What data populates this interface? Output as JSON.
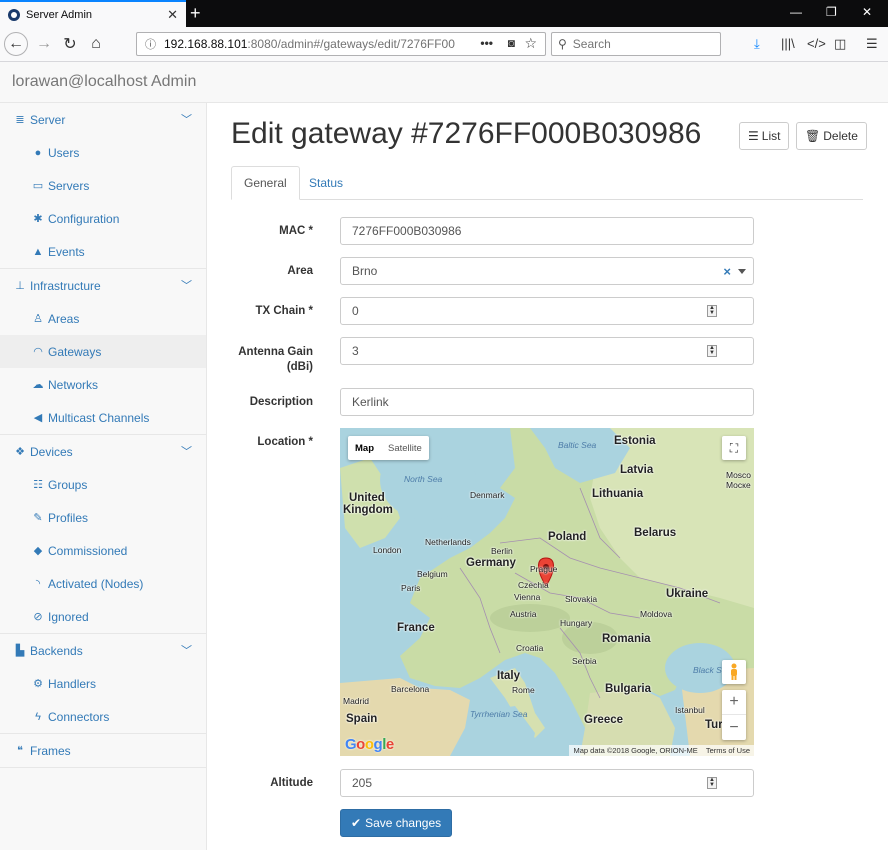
{
  "browser": {
    "tab_title": "Server Admin",
    "url_host": "192.168.88.101",
    "url_path": ":8080/admin#/gateways/edit/7276FF00",
    "search_placeholder": "Search"
  },
  "app": {
    "header_title": "lorawan@localhost Admin"
  },
  "sidebar": {
    "sections": [
      {
        "label": "Server",
        "icon": "server-icon",
        "items": [
          {
            "label": "Users",
            "icon": "user-icon"
          },
          {
            "label": "Servers",
            "icon": "monitor-icon"
          },
          {
            "label": "Configuration",
            "icon": "gear-icon"
          },
          {
            "label": "Events",
            "icon": "warning-icon"
          }
        ]
      },
      {
        "label": "Infrastructure",
        "icon": "sitemap-icon",
        "items": [
          {
            "label": "Areas",
            "icon": "person-pin-icon"
          },
          {
            "label": "Gateways",
            "icon": "wifi-icon"
          },
          {
            "label": "Networks",
            "icon": "cloud-icon"
          },
          {
            "label": "Multicast Channels",
            "icon": "bullhorn-icon"
          }
        ]
      },
      {
        "label": "Devices",
        "icon": "cubes-icon",
        "items": [
          {
            "label": "Groups",
            "icon": "grid-icon"
          },
          {
            "label": "Profiles",
            "icon": "edit-icon"
          },
          {
            "label": "Commissioned",
            "icon": "cube-icon"
          },
          {
            "label": "Activated (Nodes)",
            "icon": "rss-icon"
          },
          {
            "label": "Ignored",
            "icon": "ban-icon"
          }
        ]
      },
      {
        "label": "Backends",
        "icon": "chart-icon",
        "items": [
          {
            "label": "Handlers",
            "icon": "cogs-icon"
          },
          {
            "label": "Connectors",
            "icon": "bolt-icon"
          }
        ]
      },
      {
        "label": "Frames",
        "icon": "comments-icon",
        "items": []
      }
    ]
  },
  "page": {
    "title": "Edit gateway #7276FF000B030986",
    "list_label": "List",
    "delete_label": "Delete",
    "tabs": [
      "General",
      "Status"
    ],
    "active_tab": "General"
  },
  "form": {
    "mac_label": "MAC *",
    "mac_value": "7276FF000B030986",
    "area_label": "Area",
    "area_value": "Brno",
    "txchain_label": "TX Chain *",
    "txchain_value": "0",
    "antenna_label_1": "Antenna Gain",
    "antenna_label_2": "(dBi)",
    "antenna_value": "3",
    "description_label": "Description",
    "description_value": "Kerlink",
    "location_label": "Location *",
    "altitude_label": "Altitude",
    "altitude_value": "205",
    "save_label": "Save changes"
  },
  "map": {
    "map_button": "Map",
    "satellite_button": "Satellite",
    "attribution": "Map data ©2018 Google, ORION-ME",
    "terms": "Terms of Use",
    "labels": {
      "estonia": "Estonia",
      "latvia": "Latvia",
      "lithuania": "Lithuania",
      "baltic_sea": "Baltic Sea",
      "north_sea": "North Sea",
      "denmark": "Denmark",
      "moscow": "Mosco",
      "moscow2": "Моске",
      "uk": "United",
      "uk2": "Kingdom",
      "netherlands": "Netherlands",
      "berlin": "Berlin",
      "poland": "Poland",
      "belarus": "Belarus",
      "london": "London",
      "belgium": "Belgium",
      "germany": "Germany",
      "prague": "Prague",
      "czechia": "Czechia",
      "paris": "Paris",
      "vienna": "Vienna",
      "slovakia": "Slovakia",
      "ukraine": "Ukraine",
      "austria": "Austria",
      "hungary": "Hungary",
      "moldova": "Moldova",
      "france": "France",
      "romania": "Romania",
      "croatia": "Croatia",
      "serbia": "Serbia",
      "black_sea": "Black S",
      "italy": "Italy",
      "barcelona": "Barcelona",
      "rome": "Rome",
      "bulgaria": "Bulgaria",
      "madrid": "Madrid",
      "istanbul": "Istanbul",
      "spain": "Spain",
      "tyrrhenian": "Tyrrhenian Sea",
      "greece": "Greece",
      "turkey": "Tur"
    }
  }
}
